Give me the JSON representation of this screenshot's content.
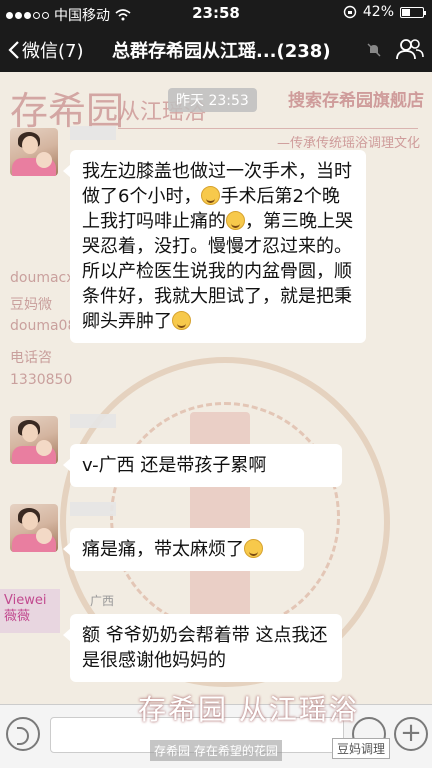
{
  "status": {
    "carrier": "中国移动",
    "time": "23:58",
    "battery_text": "42%",
    "battery_level": 0.42
  },
  "nav": {
    "back_label": "微信(7)",
    "title": "总群存希园从江瑶...(238)"
  },
  "background": {
    "logo": "存希园",
    "logo_sub": "从江瑶浴",
    "search_text": "搜索存希园旗舰店",
    "slogan": "—传承传统瑶浴调理文化",
    "side1": "doumacx",
    "side2": "豆妈微",
    "side3": "douma08",
    "side4": "电话咨",
    "side5": "1330850",
    "vivi": "Viewei 薇薇"
  },
  "chat": {
    "time_badge": "昨天 23:53",
    "messages": [
      {
        "text1": "我左边膝盖也做过一次手术，当时做了6个小时，",
        "text2": "手术后第2个晚上我打吗啡止痛的",
        "text3": "，第三晚上哭哭忍着，没打。慢慢才忍过来的。所以产检医生说我的内盆骨圆，顺条件好，我就大胆试了，就是把秉卿头弄肿了"
      },
      {
        "text": "v-广西 还是带孩子累啊"
      },
      {
        "text": "痛是痛，带太麻烦了"
      },
      {
        "name": "广西",
        "text": "额 爷爷奶奶会帮着带 这点我还是很感谢他妈妈的"
      }
    ]
  },
  "watermark": "存希园 从江瑶浴",
  "banner": "存希园  存在希望的花园",
  "banner_tag": "豆妈调理"
}
